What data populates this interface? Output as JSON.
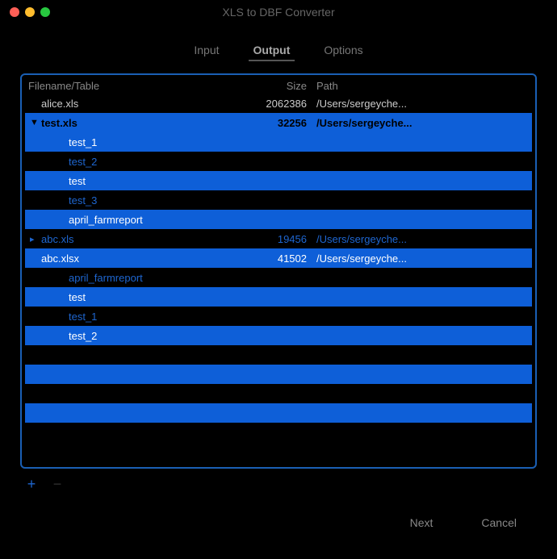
{
  "window": {
    "title": "XLS to DBF Converter"
  },
  "tabs": {
    "input": "Input",
    "output": "Output",
    "options": "Options"
  },
  "table": {
    "headers": {
      "name": "Filename/Table",
      "size": "Size",
      "path": "Path"
    },
    "rows": [
      {
        "name": "alice.xls",
        "size": "2062386",
        "path": "/Users/sergeyche...",
        "style": "blackwhite",
        "indent": 0,
        "disclosure": ""
      },
      {
        "name": "test.xls",
        "size": "32256",
        "path": "/Users/sergeyche...",
        "style": "sel",
        "indent": 0,
        "disclosure": "▼"
      },
      {
        "name": "test_1",
        "size": "",
        "path": "",
        "style": "blue",
        "indent": 1,
        "disclosure": ""
      },
      {
        "name": "test_2",
        "size": "",
        "path": "",
        "style": "black",
        "indent": 1,
        "disclosure": ""
      },
      {
        "name": "test",
        "size": "",
        "path": "",
        "style": "blue",
        "indent": 1,
        "disclosure": ""
      },
      {
        "name": "test_3",
        "size": "",
        "path": "",
        "style": "black",
        "indent": 1,
        "disclosure": ""
      },
      {
        "name": "april_farmreport",
        "size": "",
        "path": "",
        "style": "blue",
        "indent": 1,
        "disclosure": ""
      },
      {
        "name": "abc.xls",
        "size": "19456",
        "path": "/Users/sergeyche...",
        "style": "black",
        "indent": 0,
        "disclosure": "▸"
      },
      {
        "name": "abc.xlsx",
        "size": "41502",
        "path": "/Users/sergeyche...",
        "style": "blue",
        "indent": 0,
        "disclosure": ""
      },
      {
        "name": "april_farmreport",
        "size": "",
        "path": "",
        "style": "black",
        "indent": 1,
        "disclosure": ""
      },
      {
        "name": "test",
        "size": "",
        "path": "",
        "style": "blue",
        "indent": 1,
        "disclosure": ""
      },
      {
        "name": "test_1",
        "size": "",
        "path": "",
        "style": "black",
        "indent": 1,
        "disclosure": ""
      },
      {
        "name": "test_2",
        "size": "",
        "path": "",
        "style": "blue",
        "indent": 1,
        "disclosure": ""
      },
      {
        "name": "",
        "size": "",
        "path": "",
        "style": "black",
        "indent": 0,
        "disclosure": ""
      },
      {
        "name": "",
        "size": "",
        "path": "",
        "style": "blue",
        "indent": 0,
        "disclosure": ""
      },
      {
        "name": "",
        "size": "",
        "path": "",
        "style": "black",
        "indent": 0,
        "disclosure": ""
      },
      {
        "name": "",
        "size": "",
        "path": "",
        "style": "blue",
        "indent": 0,
        "disclosure": ""
      },
      {
        "name": "",
        "size": "",
        "path": "",
        "style": "black",
        "indent": 0,
        "disclosure": ""
      }
    ]
  },
  "controls": {
    "add": "+",
    "remove": "−"
  },
  "footer": {
    "next": "Next",
    "cancel": "Cancel"
  }
}
